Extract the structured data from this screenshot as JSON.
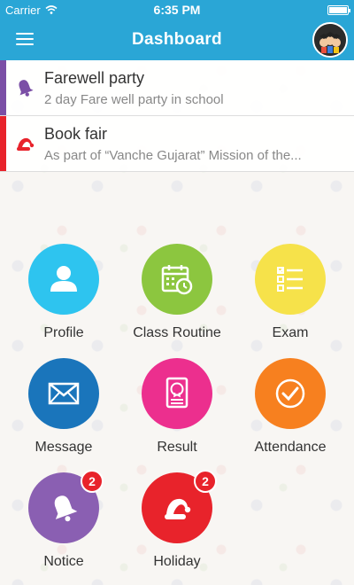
{
  "status_bar": {
    "carrier": "Carrier",
    "time": "6:35 PM",
    "battery_level": 1.0
  },
  "header": {
    "title": "Dashboard",
    "menu_icon": "hamburger-icon",
    "avatar_icon": "graduation-avatar"
  },
  "notices": [
    {
      "title": "Farewell party",
      "description": "2 day Fare well party in school",
      "icon": "bell-icon",
      "accent": "#7b4fa6"
    },
    {
      "title": "Book fair",
      "description": "As part of “Vanche Gujarat” Mission of the...",
      "icon": "santa-hat-icon",
      "accent": "#e8232b"
    }
  ],
  "tiles": [
    {
      "label": "Profile",
      "icon": "person-icon",
      "color": "#2ec4ef"
    },
    {
      "label": "Class Routine",
      "icon": "calendar-clock-icon",
      "color": "#8cc63f"
    },
    {
      "label": "Exam",
      "icon": "checklist-icon",
      "color": "#f6e24a"
    },
    {
      "label": "Message",
      "icon": "envelope-icon",
      "color": "#1a75bb"
    },
    {
      "label": "Result",
      "icon": "result-icon",
      "color": "#ec2f8e"
    },
    {
      "label": "Attendance",
      "icon": "checkmark-circle-icon",
      "color": "#f7801f"
    },
    {
      "label": "Notice",
      "icon": "bell-icon",
      "color": "#8a5fb2",
      "badge": "2"
    },
    {
      "label": "Holiday",
      "icon": "santa-hat-icon",
      "color": "#e8232b",
      "badge": "2"
    }
  ]
}
